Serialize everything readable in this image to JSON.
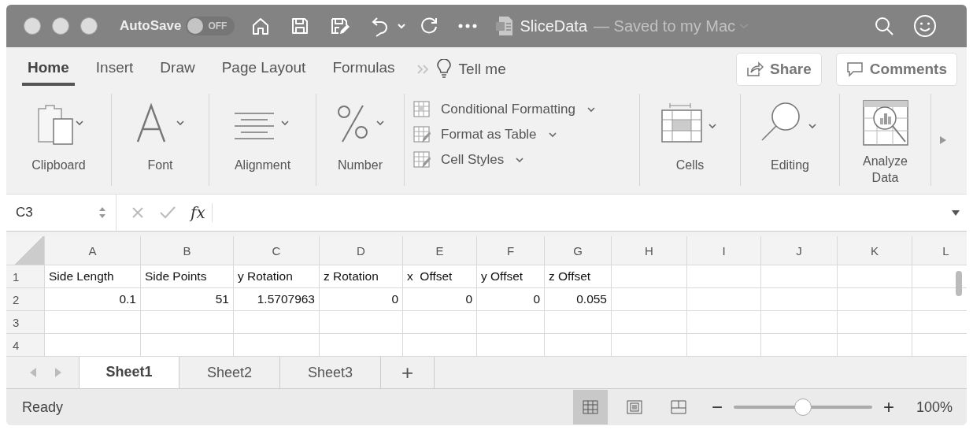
{
  "window": {
    "title": "SliceData",
    "subtitle": "— Saved to my Mac"
  },
  "autosave": {
    "label": "AutoSave",
    "on": false,
    "state_text": "OFF"
  },
  "tabs": [
    {
      "label": "Home",
      "selected": true
    },
    {
      "label": "Insert",
      "selected": false
    },
    {
      "label": "Draw",
      "selected": false
    },
    {
      "label": "Page Layout",
      "selected": false
    },
    {
      "label": "Formulas",
      "selected": false
    }
  ],
  "tell_me": "Tell me",
  "share": "Share",
  "comments": "Comments",
  "ribbon": [
    {
      "kind": "clipboard",
      "label": "Clipboard"
    },
    {
      "kind": "font",
      "label": "Font"
    },
    {
      "kind": "alignment",
      "label": "Alignment"
    },
    {
      "kind": "number",
      "label": "Number"
    },
    {
      "kind": "styles",
      "items": [
        {
          "kind": "conditional",
          "label": "Conditional Formatting"
        },
        {
          "kind": "table",
          "label": "Format as Table"
        },
        {
          "kind": "cellstyles",
          "label": "Cell Styles"
        }
      ]
    },
    {
      "kind": "cells",
      "label": "Cells"
    },
    {
      "kind": "editing",
      "label": "Editing"
    },
    {
      "kind": "analyze",
      "label": "Analyze Data"
    }
  ],
  "name_box": "C3",
  "function_label": "fx",
  "columns": [
    "A",
    "B",
    "C",
    "D",
    "E",
    "F",
    "G",
    "H",
    "I",
    "J",
    "K",
    "L"
  ],
  "rows": [
    {
      "number": "1",
      "cells": [
        {
          "kind": "text",
          "value": "Side Length"
        },
        {
          "kind": "text",
          "value": "Side Points"
        },
        {
          "kind": "text",
          "value": "y Rotation"
        },
        {
          "kind": "text",
          "value": "z Rotation"
        },
        {
          "kind": "text",
          "value": "x  Offset"
        },
        {
          "kind": "text",
          "value": "y Offset"
        },
        {
          "kind": "text",
          "value": "z Offset"
        }
      ]
    },
    {
      "number": "2",
      "cells": [
        {
          "kind": "number",
          "value": "0.1"
        },
        {
          "kind": "number",
          "value": "51"
        },
        {
          "kind": "number",
          "value": "1.5707963"
        },
        {
          "kind": "number",
          "value": "0"
        },
        {
          "kind": "number",
          "value": "0"
        },
        {
          "kind": "number",
          "value": "0"
        },
        {
          "kind": "number",
          "value": "0.055"
        }
      ]
    },
    {
      "number": "3",
      "cells": []
    },
    {
      "number": "4",
      "cells": []
    }
  ],
  "sheets": [
    {
      "label": "Sheet1",
      "selected": true
    },
    {
      "label": "Sheet2",
      "selected": false
    },
    {
      "label": "Sheet3",
      "selected": false
    }
  ],
  "add_sheet": "+",
  "status": "Ready",
  "views": [
    {
      "kind": "normal",
      "selected": true
    },
    {
      "kind": "page_layout",
      "selected": false
    },
    {
      "kind": "page_break",
      "selected": false
    }
  ],
  "zoom": {
    "level": 0.5,
    "minus": "−",
    "plus": "+",
    "reading": "100%"
  }
}
